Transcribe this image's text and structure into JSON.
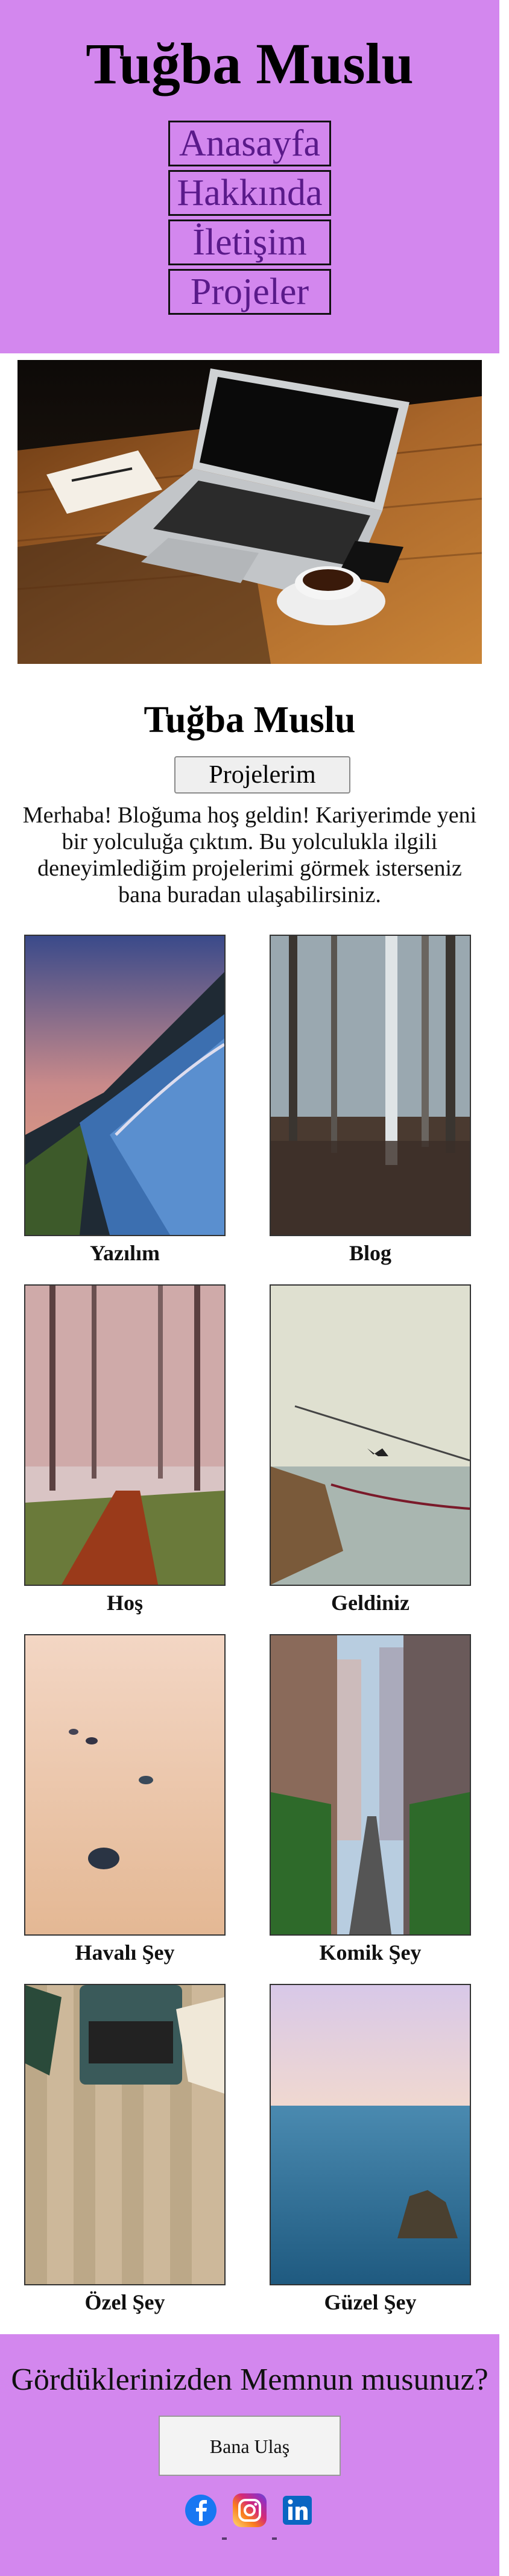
{
  "header": {
    "title": "Tuğba Muslu",
    "nav": [
      "Anasayfa",
      "Hakkında",
      "İletişim",
      "Projeler"
    ]
  },
  "intro": {
    "title": "Tuğba Muslu",
    "button_label": "Projelerim",
    "text": "Merhaba! Bloğuma hoş geldin! Kariyerimde yeni bir yolculuğa çıktım. Bu yolculukla ilgili deneyimlediğim projelerimi görmek isterseniz bana buradan ulaşabilirsiniz."
  },
  "gallery": [
    {
      "caption": "Yazılım"
    },
    {
      "caption": "Blog"
    },
    {
      "caption": "Hoş"
    },
    {
      "caption": "Geldiniz"
    },
    {
      "caption": "Havalı Şey"
    },
    {
      "caption": "Komik Şey"
    },
    {
      "caption": "Özel Şey"
    },
    {
      "caption": "Güzel Şey"
    }
  ],
  "footer": {
    "question": "Gördüklerinizden Memnun musunuz?",
    "button_label": "Bana Ulaş",
    "social": [
      "facebook-icon",
      "instagram-icon",
      "linkedin-icon"
    ]
  },
  "colors": {
    "header_bg": "#d387ee",
    "nav_text": "#5a1a8a"
  }
}
